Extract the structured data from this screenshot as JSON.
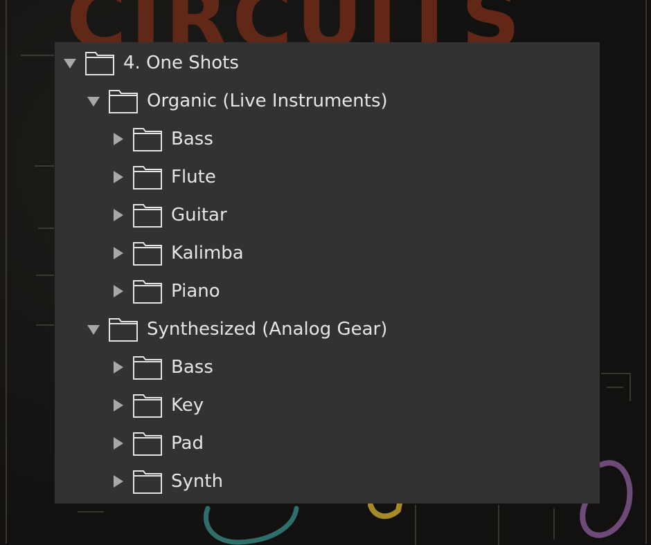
{
  "tree": {
    "root": {
      "label": "4. One Shots",
      "state": "expanded",
      "icon": "folder-icon"
    },
    "groups": [
      {
        "label": "Organic (Live Instruments)",
        "state": "expanded",
        "icon": "folder-icon",
        "children": [
          {
            "label": "Bass",
            "state": "collapsed",
            "icon": "folder-icon"
          },
          {
            "label": "Flute",
            "state": "collapsed",
            "icon": "folder-icon"
          },
          {
            "label": "Guitar",
            "state": "collapsed",
            "icon": "folder-icon"
          },
          {
            "label": "Kalimba",
            "state": "collapsed",
            "icon": "folder-icon"
          },
          {
            "label": "Piano",
            "state": "collapsed",
            "icon": "folder-icon"
          }
        ]
      },
      {
        "label": "Synthesized (Analog Gear)",
        "state": "expanded",
        "icon": "folder-icon",
        "children": [
          {
            "label": "Bass",
            "state": "collapsed",
            "icon": "folder-icon"
          },
          {
            "label": "Key",
            "state": "collapsed",
            "icon": "folder-icon"
          },
          {
            "label": "Pad",
            "state": "collapsed",
            "icon": "folder-icon"
          },
          {
            "label": "Synth",
            "state": "collapsed",
            "icon": "folder-icon"
          }
        ]
      }
    ]
  },
  "colors": {
    "panel_bg": "#323232",
    "text": "#e6e6e6",
    "disclosure": "#a8a8a8"
  }
}
